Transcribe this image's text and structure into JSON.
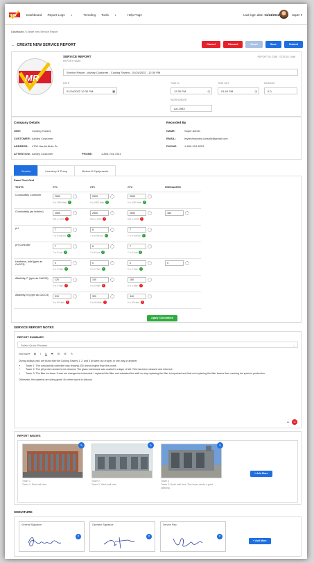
{
  "nav": {
    "items": [
      "Dashboard",
      "Report Logs",
      "Trending",
      "Tools",
      "Help Page"
    ],
    "login_label": "Last login date:",
    "login_date": "01/24/2022",
    "user": "Super"
  },
  "breadcrumb": {
    "root": "Dashboard",
    "sep": " / ",
    "current": "Create new Service Report"
  },
  "page": {
    "title": "CREATE NEW SERVICE REPORT",
    "buttons": {
      "cancel": "Cancel",
      "discard": "Discard",
      "email": "Email",
      "save": "Save",
      "submit": "Submit"
    }
  },
  "report": {
    "heading": "SERVICE REPORT",
    "name_label": "REPORT NAME",
    "name_value": "Service Report - Ashley Customer - Cooling Towers - 01/24/2022 - 12:30 PM",
    "id_label": "REPORT ID: 2398",
    "status_label": "STATUS: Draft",
    "date_label": "DATE",
    "date_value": "01/24/2022 12:30 PM",
    "time_in_label": "TIME IN",
    "time_in_value": "12:30 PM",
    "time_out_label": "TIME OUT",
    "time_out_value": "01:40 PM",
    "mileage_label": "MILEAGE",
    "mileage_value": "0.0",
    "workorder_label": "WORKORDER",
    "workorder_value": "AA-1983"
  },
  "company": {
    "heading": "Company Details",
    "unit_label": "UNIT:",
    "unit": "Cooling Towers",
    "customer_label": "CUSTOMER:",
    "customer": "Ashley Customer",
    "address_label": "ADDRESS:",
    "address": "4700 Harold Abitz Dr",
    "attention_label": "ATTENTION:",
    "attention": "Ashley Customer",
    "phone_label": "PHONE:",
    "phone": "1-800-743-7431"
  },
  "recorded": {
    "heading": "Recorded By",
    "name_label": "NAME:",
    "name": "Super Admin",
    "email_label": "EMAIL:",
    "email": "mytechreports.console@gmail.com",
    "phone_label": "PHONE:",
    "phone": "1-800-224-5253"
  },
  "tabs": [
    "Service",
    "Inventory & Pump",
    "Meters & Equipments"
  ],
  "grid": {
    "title": "Panel Test Grid",
    "columns": [
      "TESTS",
      "CT1",
      "CT2",
      "CT3",
      "FEEDWATER"
    ],
    "rows": [
      {
        "test": "Conductivity Controller",
        "v1": "2500",
        "r1": "0 to 3000 High",
        "s1": "ok",
        "v2": "2500",
        "r2": "0 to 3000 High",
        "s2": "ok",
        "v3": "2500",
        "r3": "0 to 3000 High",
        "s3": "ok",
        "fw": ""
      },
      {
        "test": "Conductivity (as Instrinu)",
        "v1": "2500",
        "r1": "800 to 1500",
        "s1": "bad",
        "v2": "2500",
        "r2": "800 to 1500",
        "s2": "bad",
        "v3": "2500",
        "r3": "800 to 1500",
        "s3": "bad",
        "fw": "180"
      },
      {
        "test": "pH",
        "v1": "7",
        "r1": "7 to 8 Normal",
        "s1": "ok",
        "v2": "8",
        "r2": "7 to 8 Normal",
        "s2": "ok",
        "v3": "7",
        "r3": "7 to 8 Normal",
        "s3": "ok",
        "fw": ""
      },
      {
        "test": "pH Controller",
        "v1": "7",
        "r1": "7 to 8 Low",
        "s1": "ok",
        "v2": "8",
        "r2": "7 to 8 Low",
        "s2": "ok",
        "v3": "7",
        "r3": "7 to 8 Low",
        "s3": "ok",
        "fw": ""
      },
      {
        "test": "Hardness, total (ppm as CaCO3)",
        "v1": "0",
        "r1": "0 to 2 High",
        "s1": "ok",
        "v2": "0",
        "r2": "0 to 2 High",
        "s2": "ok",
        "v3": "0",
        "r3": "0 to 2 High",
        "s3": "ok",
        "fw": "0"
      },
      {
        "test": "Alkalinity, P (ppm as CaCO3)",
        "v1": "120",
        "r1": "0 to 0 High",
        "s1": "bad",
        "v2": "140",
        "r2": "0 to 0 High",
        "s2": "bad",
        "v3": "180",
        "r3": "0 to 0 High",
        "s3": "bad",
        "fw": ""
      },
      {
        "test": "Alkalinity, M (ppm as CaCO3)",
        "v1": "310",
        "r1": "0 to 60 High",
        "s1": "bad",
        "v2": "320",
        "r2": "0 to 60 High",
        "s2": "bad",
        "v3": "340",
        "r3": "0 to 60 High",
        "s3": "bad",
        "fw": ""
      }
    ],
    "apply": "Apply Calculation"
  },
  "notes": {
    "heading": "SERVICE REPORT NOTES",
    "summary_label": "REPORT SUMMARY",
    "phrases_placeholder": "Select Quick Phrases",
    "toolbar": [
      "Normal",
      "B",
      "I",
      "U",
      "S",
      "☰",
      "☰",
      "✎"
    ],
    "intro": "During today's visit, we found that the Cooling Towers 1, 2, and 3 all were out of spec in one way or another.",
    "bullets": [
      "Tower 1: The conductivity controller was reading 200 umhos higher than the probe",
      "Tower 2: The pH probe needed to be cleaned. The glass membrane was coated in a layer of silt. This has been cleaned and returned.",
      "Tower 3: The filter for tower 3 was not changed as instructed. I replaced the filter and educated the staff on why replacing the filter is important and that not replacing the filter lowers flow, causing hot spots in production."
    ],
    "outro": "Otherwise, the systems are doing great. No other topics to discuss."
  },
  "images": {
    "heading": "REPORT IMAGES",
    "items": [
      {
        "title": "Tower 1",
        "desc": "Tower 1, East wall view"
      },
      {
        "title": "Tower 2",
        "desc": "Tower 2, West wall view"
      },
      {
        "title": "Tower 3",
        "desc": "Tower 3, North wall view. This tower needs a good cleaning"
      }
    ],
    "add_more": "+ Add More"
  },
  "signature": {
    "heading": "SIGNATURE",
    "boxes": [
      {
        "label": "General Signature"
      },
      {
        "label": "Operator Signature"
      },
      {
        "label": "Service Rep."
      }
    ],
    "add_more": "+ Add More"
  },
  "colors": {
    "primary": "#1f6fe0",
    "danger": "#e6202b",
    "success": "#2eaa3e"
  }
}
